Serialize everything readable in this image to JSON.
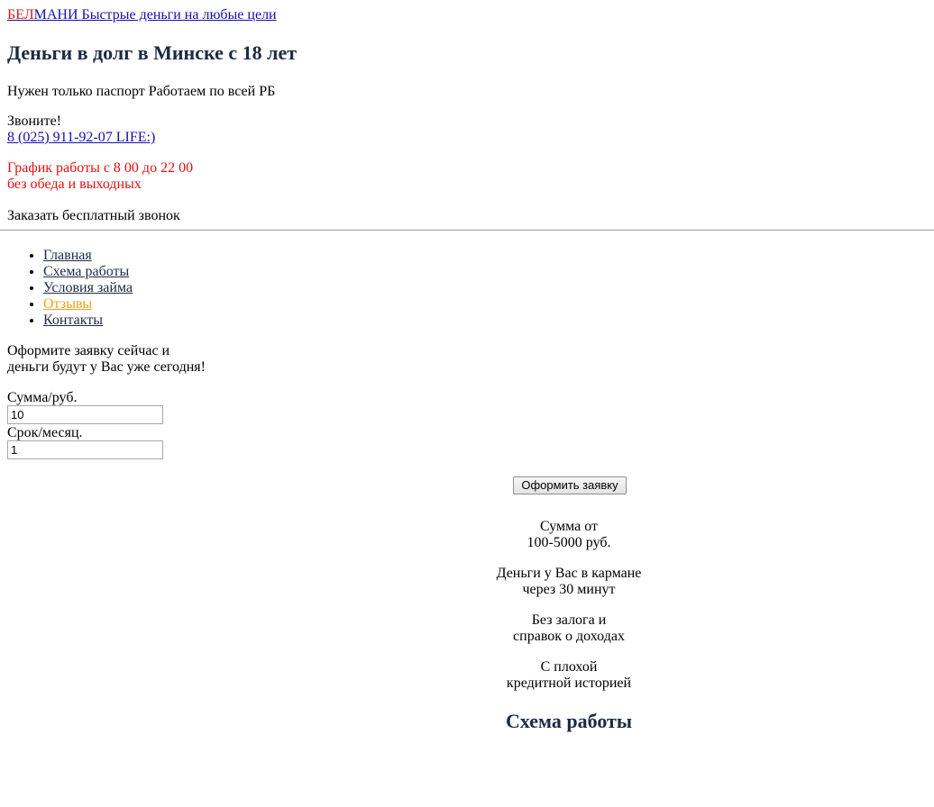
{
  "brand": {
    "part1": "БЕЛ",
    "part2": "МАНИ",
    "tagline": "Быстрые деньги на любые цели"
  },
  "headline": "Деньги в долг в Минске с 18 лет",
  "subline": "Нужен только паспорт Работаем по всей РБ",
  "call": {
    "label": "Звоните!",
    "phone": "8 (025) 911-92-07 LIFE:)"
  },
  "schedule": {
    "line1": "График работы с 8 00 до 22 00",
    "line2": "без обеда и выходных"
  },
  "callback_label": "Заказать бесплатный звонок",
  "nav": {
    "items": [
      {
        "label": "Главная"
      },
      {
        "label": "Схема работы"
      },
      {
        "label": "Условия займа"
      },
      {
        "label": "Отзывы"
      },
      {
        "label": "Контакты"
      }
    ]
  },
  "cta": {
    "line1": "Оформите заявку сейчас и",
    "line2": "деньги будут у Вас уже сегодня!"
  },
  "form": {
    "sum_label": "Сумма/руб.",
    "sum_value": "10",
    "term_label": "Срок/месяц.",
    "term_value": "1",
    "submit_label": "Оформить заявку"
  },
  "features": [
    {
      "line1": "Сумма от",
      "line2": "100-5000 руб."
    },
    {
      "line1": "Деньги у Вас в кармане",
      "line2": "через 30 минут"
    },
    {
      "line1": "Без залога и",
      "line2": "справок о доходах"
    },
    {
      "line1": "С плохой",
      "line2": "кредитной историей"
    }
  ],
  "section_title": "Схема работы",
  "colors": {
    "brand_red": "#d11a1a",
    "link_blue": "#1a0dab",
    "heading_navy": "#1c2a44",
    "schedule_red": "#e01010",
    "nav_active": "#f0a020"
  }
}
